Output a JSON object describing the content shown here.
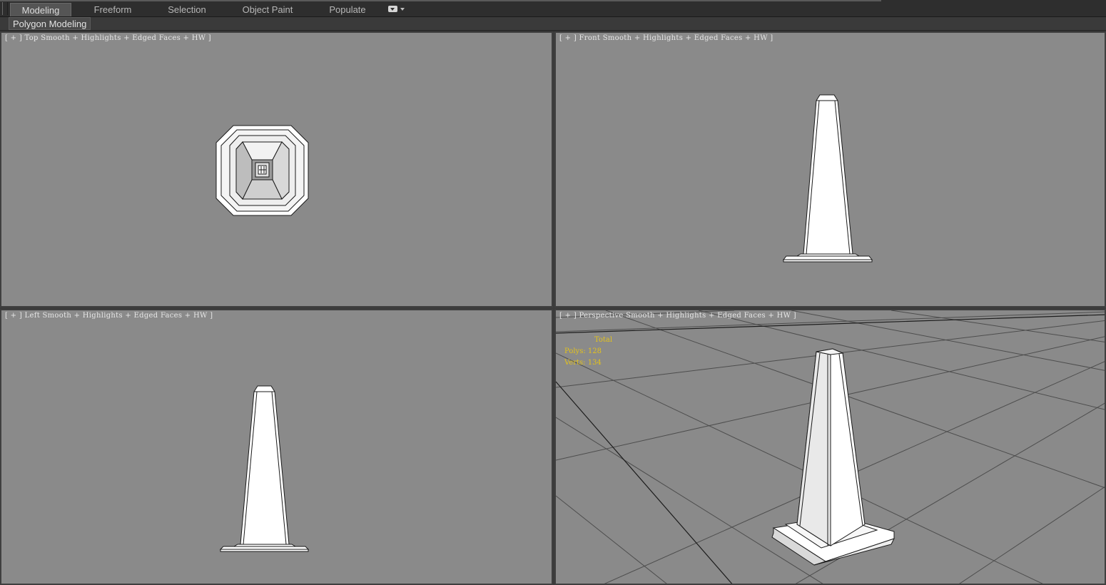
{
  "ribbon": {
    "tabs": [
      {
        "label": "Modeling",
        "active": true
      },
      {
        "label": "Freeform",
        "active": false
      },
      {
        "label": "Selection",
        "active": false
      },
      {
        "label": "Object Paint",
        "active": false
      },
      {
        "label": "Populate",
        "active": false
      }
    ],
    "options_icon": "dropdown-options-icon",
    "panel_label": "Polygon Modeling"
  },
  "viewports": {
    "top": {
      "plus": "[ + ]",
      "name": "Top",
      "shading": "Smooth + Highlights + Edged Faces + HW",
      "close": "]"
    },
    "front": {
      "plus": "[ + ]",
      "name": "Front",
      "shading": "Smooth + Highlights + Edged Faces + HW",
      "close": "]"
    },
    "left": {
      "plus": "[ + ]",
      "name": "Left",
      "shading": "Smooth + Highlights + Edged Faces + HW",
      "close": "]"
    },
    "perspective": {
      "plus": "[ + ]",
      "name": "Perspective",
      "shading": "Smooth + Highlights + Edged Faces + HW",
      "close": "]",
      "stats": {
        "total_label": "Total",
        "polys_label": "Polys:",
        "polys_value": "128",
        "verts_label": "Verts:",
        "verts_value": "134"
      }
    }
  },
  "colors": {
    "viewport_bg": "#8a8a8a",
    "stats_text": "#e3c21c",
    "active_tab": "#555555"
  }
}
